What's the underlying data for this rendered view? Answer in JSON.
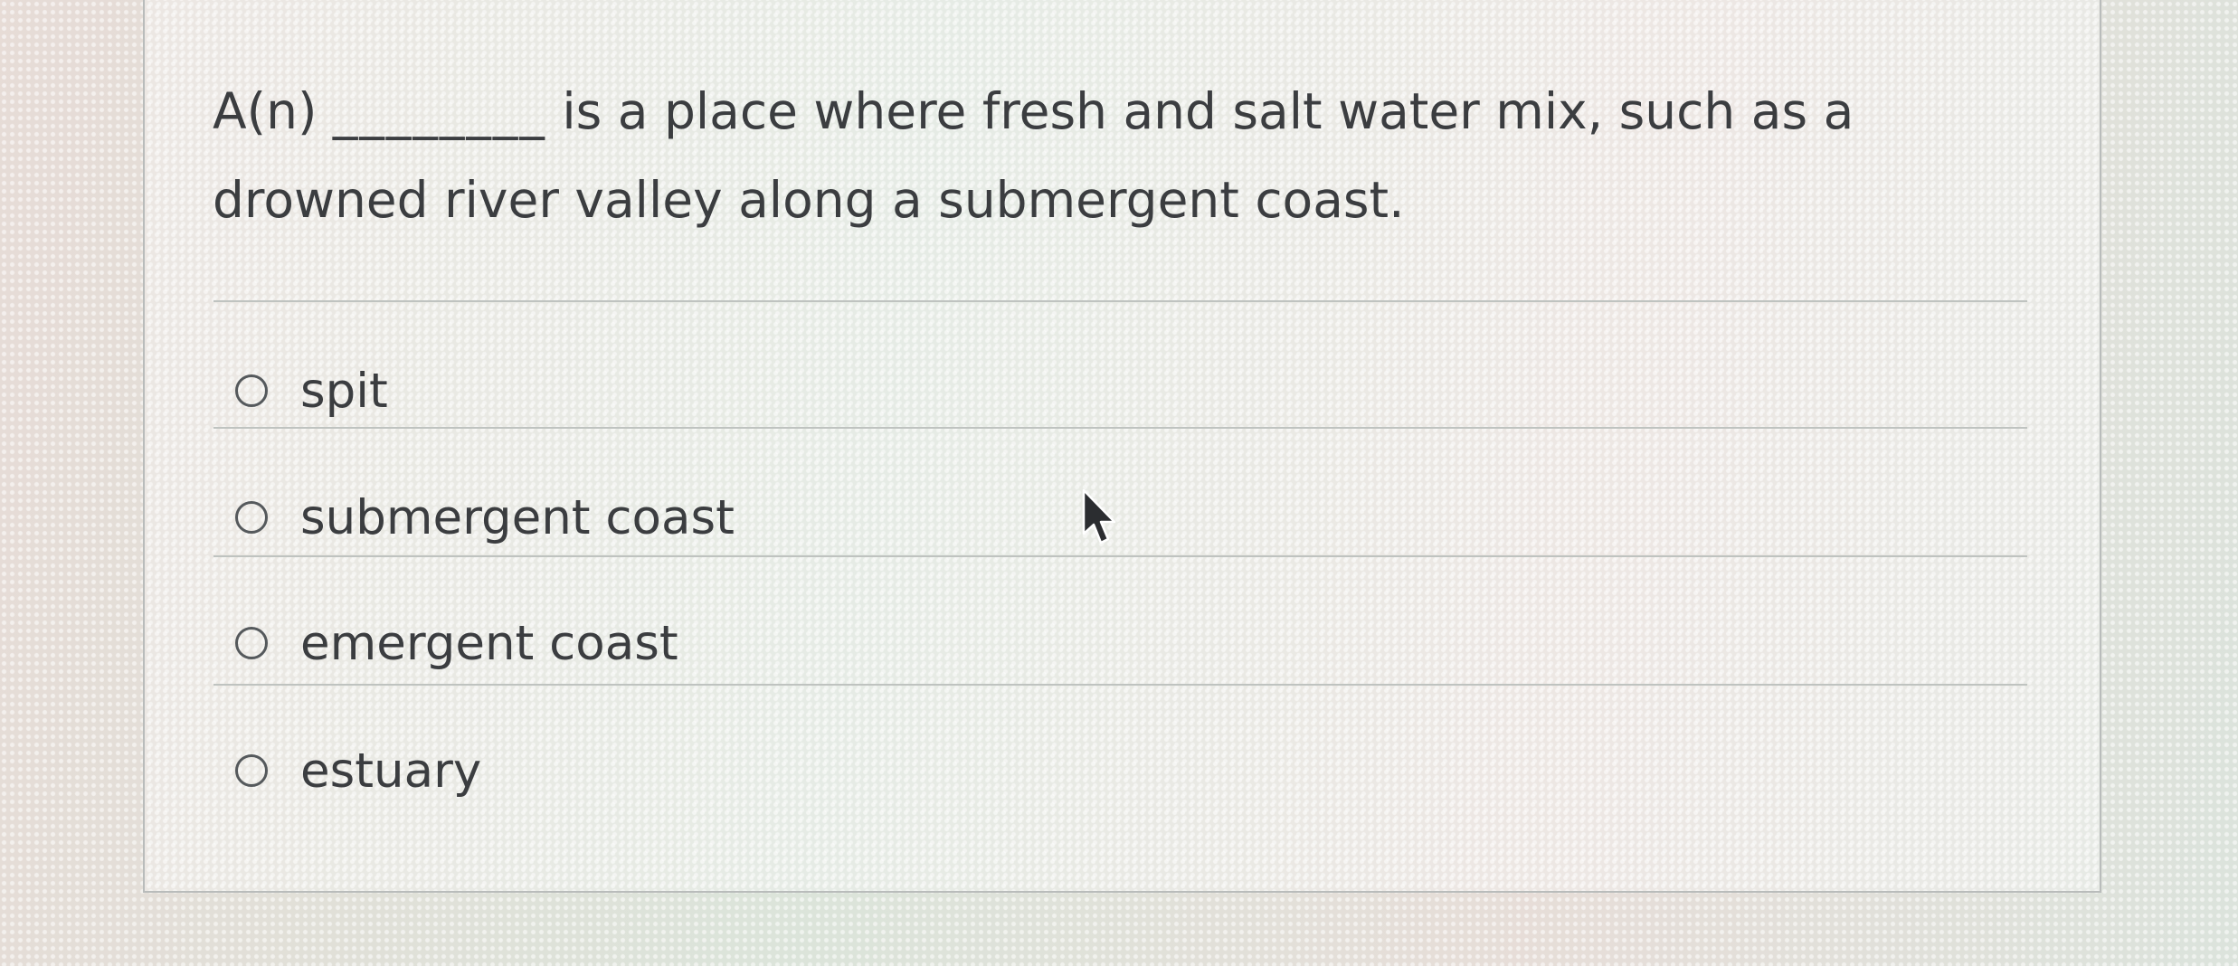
{
  "question": {
    "prefix": "A(n)",
    "blank": "________",
    "text": "is a place where fresh and salt water mix, such as a drowned river valley along a submergent coast."
  },
  "options": [
    {
      "label": "spit",
      "selected": false
    },
    {
      "label": "submergent coast",
      "selected": false
    },
    {
      "label": "emergent coast",
      "selected": false
    },
    {
      "label": "estuary",
      "selected": false
    }
  ],
  "icons": {
    "radio": "radio-button-icon",
    "cursor": "mouse-pointer-icon"
  }
}
